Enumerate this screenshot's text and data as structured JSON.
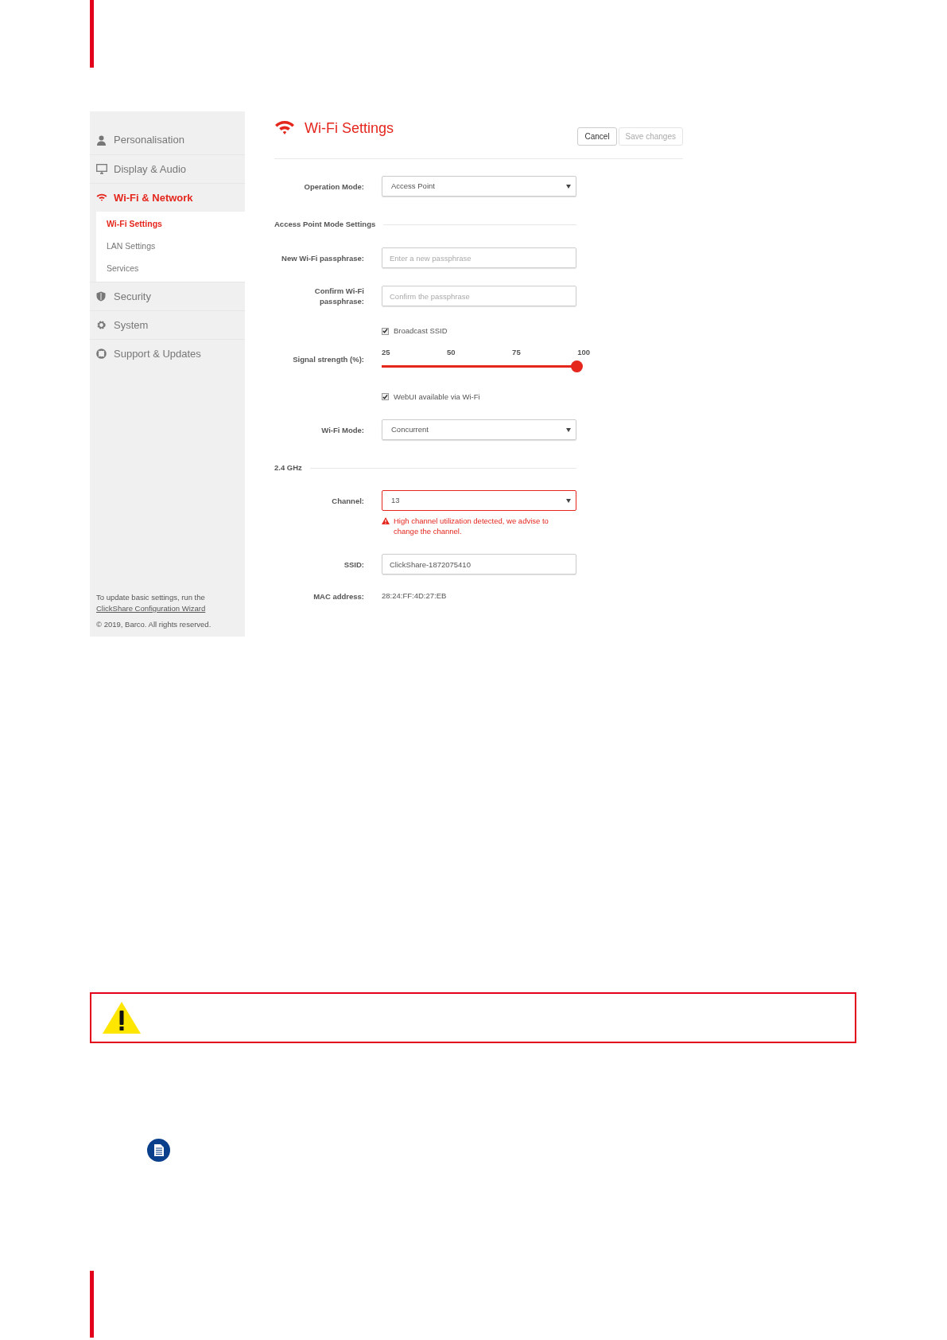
{
  "sidebar": {
    "items": [
      {
        "label": "Personalisation",
        "selected": false
      },
      {
        "label": "Display & Audio",
        "selected": false
      },
      {
        "label": "Wi-Fi & Network",
        "selected": true,
        "children": [
          {
            "label": "Wi-Fi Settings",
            "selected": true
          },
          {
            "label": "LAN Settings",
            "selected": false
          },
          {
            "label": "Services",
            "selected": false
          }
        ]
      },
      {
        "label": "Security",
        "selected": false
      },
      {
        "label": "System",
        "selected": false
      },
      {
        "label": "Support & Updates",
        "selected": false
      }
    ],
    "footer": {
      "text": "To update basic settings, run the",
      "link": "ClickShare Configuration Wizard",
      "copyright": "© 2019, Barco. All rights reserved."
    }
  },
  "main": {
    "title": "Wi-Fi Settings",
    "buttons": [
      {
        "label": "Cancel",
        "disabled": false
      },
      {
        "label": "Save changes",
        "disabled": true
      }
    ],
    "form": [
      {
        "kind": "select",
        "label": "Operation Mode:",
        "value": "Access Point"
      },
      {
        "kind": "section",
        "label": "Access Point Mode Settings"
      },
      {
        "kind": "input",
        "label": "New Wi-Fi passphrase:",
        "placeholder": "Enter a new passphrase"
      },
      {
        "kind": "input",
        "label": "Confirm Wi-Fi\npassphrase:",
        "placeholder": "Confirm the passphrase"
      },
      {
        "kind": "checkbox",
        "label": "Broadcast SSID",
        "checked": true
      },
      {
        "kind": "slider",
        "label": "Signal strength (%):",
        "ticks": [
          "25",
          "50",
          "75",
          "100"
        ],
        "level": 1
      },
      {
        "kind": "checkbox",
        "label": "WebUI available via Wi-Fi",
        "checked": true
      },
      {
        "kind": "select",
        "label": "Wi-Fi Mode:",
        "value": "Concurrent"
      },
      {
        "kind": "section",
        "label": "2.4 GHz"
      },
      {
        "kind": "select",
        "label": "Channel:",
        "value": "13",
        "error": "High channel utilization detected, we advise to change the channel."
      },
      {
        "kind": "input",
        "label": "SSID:",
        "value": "ClickShare-1872075410"
      },
      {
        "kind": "text",
        "label": "MAC address:",
        "value": "28:24:FF:4D:27:EB"
      }
    ]
  }
}
